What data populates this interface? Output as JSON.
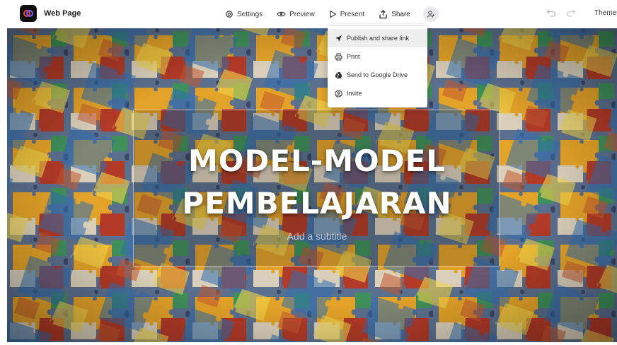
{
  "app": {
    "title": "Web Page",
    "logo_icon": "link-loop-icon",
    "accent": "#e8453c"
  },
  "nav": {
    "settings": "Settings",
    "preview": "Preview",
    "present": "Present",
    "share": "Share",
    "themes": "Themes"
  },
  "share_menu": {
    "items": [
      {
        "label": "Publish and share link",
        "icon": "send-icon"
      },
      {
        "label": "Print",
        "icon": "printer-icon"
      },
      {
        "label": "Send to Google Drive",
        "icon": "google-drive-icon"
      },
      {
        "label": "Invite",
        "icon": "invite-icon"
      }
    ]
  },
  "slide": {
    "title": "MODEL-MODEL\nPEMBELAJARAN",
    "subtitle_placeholder": "Add a subtitle",
    "background": "jigsaw-puzzle-pieces-photo"
  }
}
